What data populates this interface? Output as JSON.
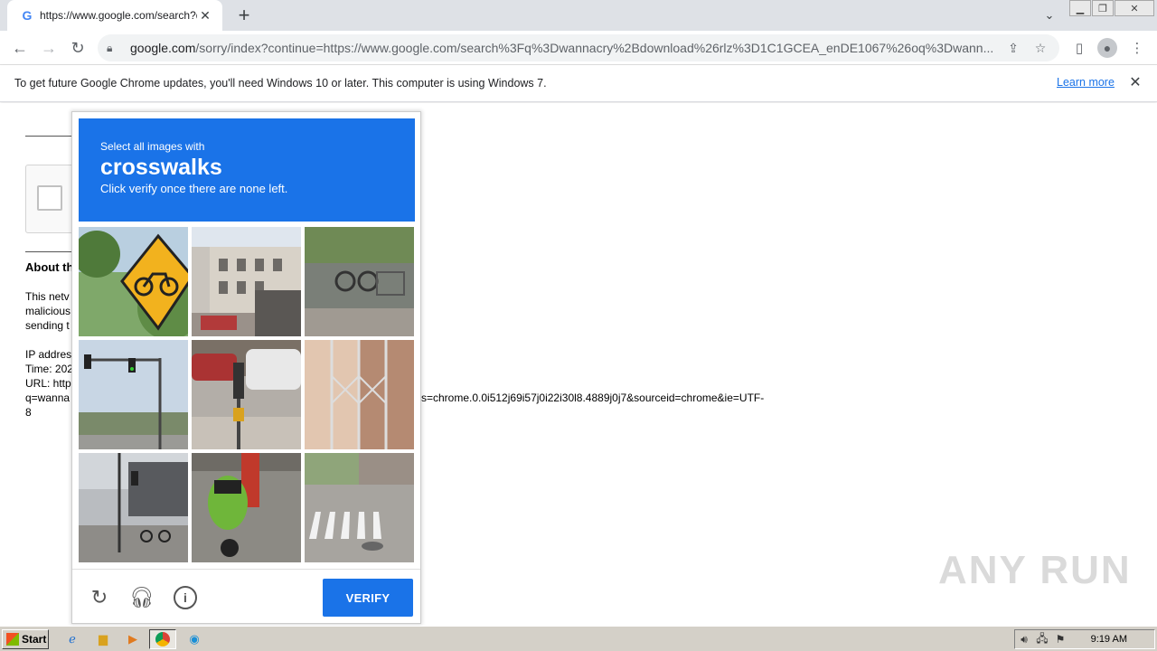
{
  "browser": {
    "tab_title": "https://www.google.com/search?q=",
    "new_tab": "+",
    "url_host": "google.com",
    "url_rest": "/sorry/index?continue=https://www.google.com/search%3Fq%3Dwannacry%2Bdownload%26rlz%3D1C1GCEA_enDE1067%26oq%3Dwann..."
  },
  "infobar": {
    "message": "To get future Google Chrome updates, you'll need Windows 10 or later. This computer is using Windows 7.",
    "learn_more": "Learn more"
  },
  "page": {
    "about_heading": "About th",
    "para_line1": "This netv",
    "para_line2": "malicious",
    "para_line3": "sending t",
    "ip_label": "IP addres",
    "time_label": "Time: 202",
    "url_label": "URL: http",
    "url_line2": "q=wanna",
    "url_line3": "8",
    "url_tail": "s=chrome.0.0i512j69i57j0i22i30l8.4889j0j7&sourceid=chrome&ie=UTF-"
  },
  "challenge": {
    "instruction": "Select all images with",
    "target": "crosswalks",
    "subtext": "Click verify once there are none left.",
    "verify_label": "VERIFY"
  },
  "watermark": "ANY RUN",
  "taskbar": {
    "start_label": "Start",
    "clock": "9:19 AM"
  },
  "colors": {
    "accent": "#1a73e8",
    "taskbar": "#d4d0c8"
  }
}
